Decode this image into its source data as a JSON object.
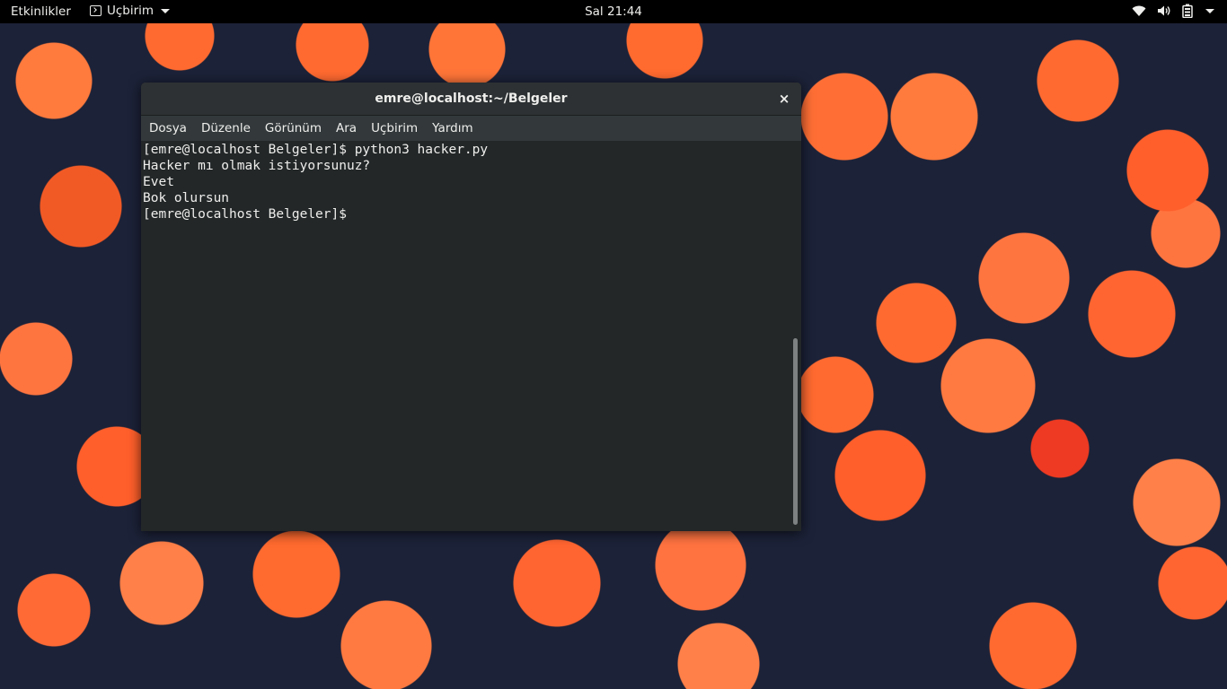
{
  "topbar": {
    "activities": "Etkinlikler",
    "app_menu_label": "Uçbirim",
    "clock": "Sal 21:44"
  },
  "window": {
    "title": "emre@localhost:~/Belgeler",
    "close_glyph": "×",
    "menu": [
      "Dosya",
      "Düzenle",
      "Görünüm",
      "Ara",
      "Uçbirim",
      "Yardım"
    ]
  },
  "terminal": {
    "lines": [
      "[emre@localhost Belgeler]$ python3 hacker.py",
      "Hacker mı olmak istiyorsunuz?",
      "Evet",
      "Bok olursun",
      "[emre@localhost Belgeler]$ "
    ]
  },
  "icons": {
    "app_menu": "terminal-icon",
    "status": [
      "wifi-icon",
      "volume-icon",
      "battery-icon",
      "chevron-down-icon"
    ]
  },
  "colors": {
    "topbar_bg": "#000000",
    "terminal_bg": "#232728",
    "terminal_fg": "#eeeeec",
    "titlebar_bg": "#2d3133"
  }
}
